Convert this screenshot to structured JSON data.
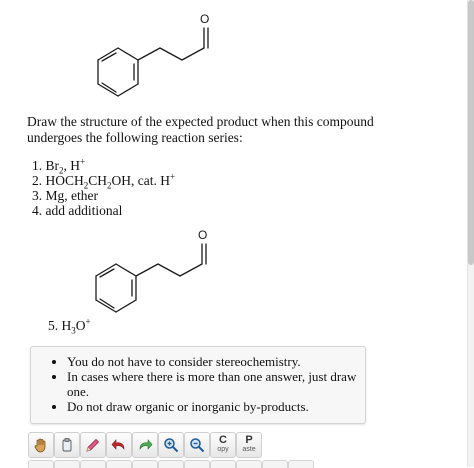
{
  "question": {
    "text": "Draw the structure of the expected product when this compound undergoes the following reaction series:"
  },
  "molecule_label": "O",
  "steps": [
    {
      "num": "1.",
      "pre": "Br",
      "sub1": "2",
      "mid": ", H",
      "sup": "+"
    },
    {
      "num": "2.",
      "pre": "HOCH",
      "sub1": "2",
      "mid": "CH",
      "sub2": "2",
      "post": "OH, cat. H",
      "sup": "+"
    },
    {
      "num": "3.",
      "text": "Mg, ether"
    },
    {
      "num": "4.",
      "text": "add additional"
    }
  ],
  "step5": {
    "num": "5.",
    "pre": "H",
    "sub": "3",
    "mid": "O",
    "sup": "+"
  },
  "hints": [
    "You do not have to consider stereochemistry.",
    "In cases where there is more than one answer, just draw one.",
    "Do not draw organic or inorganic by-products."
  ],
  "toolbar": {
    "copy": {
      "big": "C",
      "small": "opy"
    },
    "paste": {
      "big": "P",
      "small": "aste"
    }
  }
}
